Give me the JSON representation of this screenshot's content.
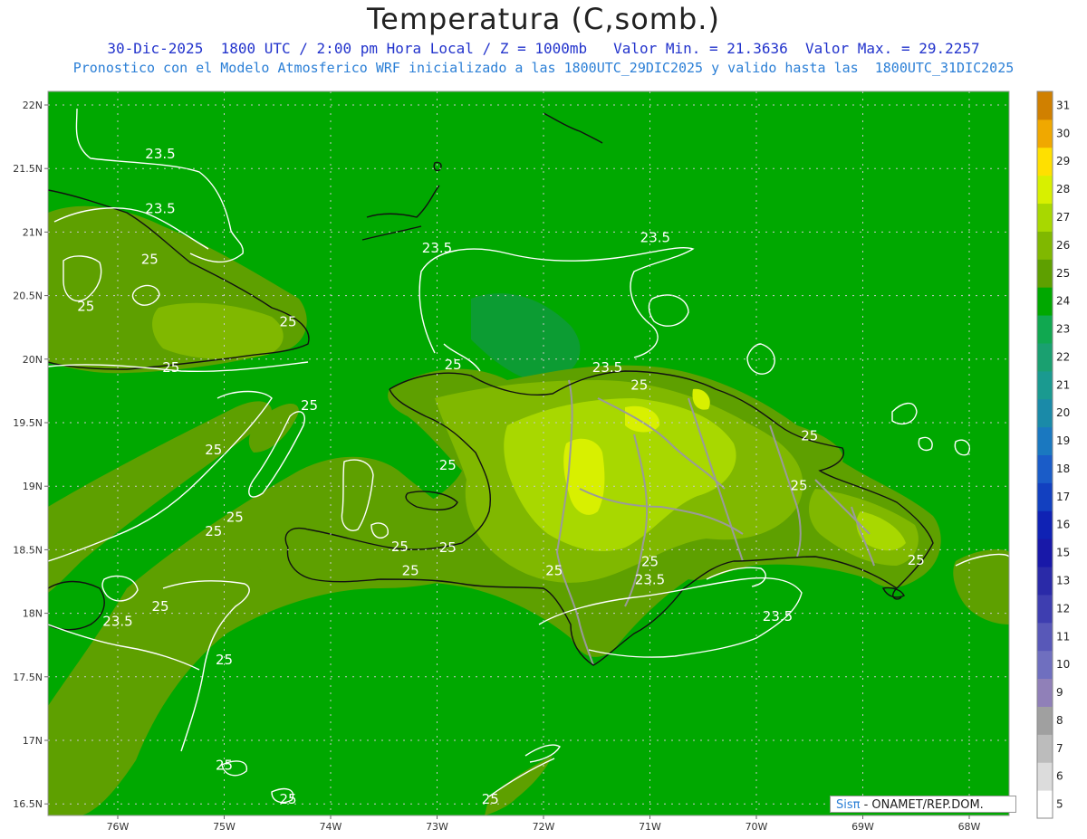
{
  "header": {
    "title": "Temperatura (C,somb.)",
    "subtitle_line1": "30-Dic-2025  1800 UTC / 2:00 pm Hora Local / Z = 1000mb   Valor Min. = 21.3636  Valor Max. = 29.2257",
    "subtitle_line2": "Pronostico con el Modelo Atmosferico WRF inicializado a las 1800UTC_29DIC2025 y valido hasta las  1800UTC_31DIC2025"
  },
  "map": {
    "lat_labels": [
      "22N",
      "21.5N",
      "21N",
      "20.5N",
      "20N",
      "19.5N",
      "19N",
      "18.5N",
      "18N",
      "17.5N",
      "17N",
      "16.5N"
    ],
    "lon_labels": [
      "76W",
      "75W",
      "74W",
      "73W",
      "72W",
      "71W",
      "70W",
      "69W",
      "68W"
    ],
    "contour_labels": [
      {
        "text": "23.5",
        "lon": -75.6,
        "lat": 21.58
      },
      {
        "text": "23.5",
        "lon": -75.6,
        "lat": 21.15
      },
      {
        "text": "25",
        "lon": -75.7,
        "lat": 20.75
      },
      {
        "text": "25",
        "lon": -76.3,
        "lat": 20.38
      },
      {
        "text": "25",
        "lon": -74.4,
        "lat": 20.26
      },
      {
        "text": "25",
        "lon": -75.5,
        "lat": 19.9
      },
      {
        "text": "23.5",
        "lon": -73.0,
        "lat": 20.84
      },
      {
        "text": "23.5",
        "lon": -70.95,
        "lat": 20.92
      },
      {
        "text": "25",
        "lon": -72.85,
        "lat": 19.92
      },
      {
        "text": "23.5",
        "lon": -71.4,
        "lat": 19.9
      },
      {
        "text": "25",
        "lon": -71.1,
        "lat": 19.76
      },
      {
        "text": "25",
        "lon": -74.2,
        "lat": 19.6
      },
      {
        "text": "25",
        "lon": -75.1,
        "lat": 19.25
      },
      {
        "text": "25",
        "lon": -72.9,
        "lat": 19.13
      },
      {
        "text": "25",
        "lon": -69.5,
        "lat": 19.36
      },
      {
        "text": "25",
        "lon": -69.6,
        "lat": 18.97
      },
      {
        "text": "25",
        "lon": -74.9,
        "lat": 18.72
      },
      {
        "text": "25",
        "lon": -75.1,
        "lat": 18.61
      },
      {
        "text": "25",
        "lon": -73.35,
        "lat": 18.49
      },
      {
        "text": "25",
        "lon": -72.9,
        "lat": 18.48
      },
      {
        "text": "25",
        "lon": -73.25,
        "lat": 18.3
      },
      {
        "text": "25",
        "lon": -71.9,
        "lat": 18.3
      },
      {
        "text": "25",
        "lon": -71.0,
        "lat": 18.37
      },
      {
        "text": "23.5",
        "lon": -71.0,
        "lat": 18.23
      },
      {
        "text": "25",
        "lon": -68.5,
        "lat": 18.38
      },
      {
        "text": "25",
        "lon": -75.6,
        "lat": 18.02
      },
      {
        "text": "23.5",
        "lon": -76.0,
        "lat": 17.9
      },
      {
        "text": "23.5",
        "lon": -69.8,
        "lat": 17.94
      },
      {
        "text": "25",
        "lon": -75.0,
        "lat": 17.6
      },
      {
        "text": "25",
        "lon": -75.0,
        "lat": 16.77
      },
      {
        "text": "25",
        "lon": -74.4,
        "lat": 16.5
      },
      {
        "text": "25",
        "lon": -72.5,
        "lat": 16.5
      }
    ]
  },
  "colorbar": {
    "labels": [
      "5",
      "6",
      "7",
      "8",
      "9",
      "10",
      "11",
      "12",
      "13",
      "15",
      "16",
      "17",
      "18",
      "19",
      "20",
      "21",
      "22",
      "23",
      "24",
      "25",
      "26",
      "27",
      "28",
      "29",
      "30",
      "31"
    ],
    "colors": [
      "#ffffff",
      "#dcdcdc",
      "#bcbcbc",
      "#a0a0a0",
      "#9080b8",
      "#6f6fbf",
      "#5858b8",
      "#3e3eb0",
      "#2a2aa8",
      "#1818a8",
      "#0f22b4",
      "#1240c0",
      "#1a5cc8",
      "#1a78c0",
      "#1a8aa8",
      "#1a9a90",
      "#1aa070",
      "#10a850",
      "#00a800",
      "#5ea000",
      "#80b800",
      "#a8d800",
      "#d8f000",
      "#ffe000",
      "#f0a800",
      "#d08000"
    ]
  },
  "credit": {
    "logo_text": "Sisπ",
    "text": " - ONAMET/REP.DOM."
  },
  "colors": {
    "sea": "#00a800",
    "band25": "#5ea000",
    "band26": "#80b800",
    "band27": "#a8d800",
    "band28": "#d8f000",
    "cool": "#0e9a3c",
    "coast": "#111111",
    "border": "#9a9a9a",
    "contour": "#ffffff",
    "grid": "#c8c8c8"
  }
}
